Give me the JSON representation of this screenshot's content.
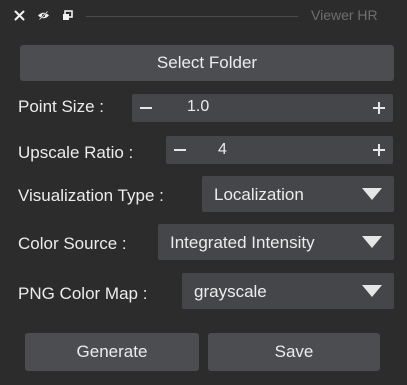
{
  "titlebar": {
    "title": "Viewer HR",
    "icons": [
      "close-icon",
      "eye-icon",
      "restore-icon"
    ]
  },
  "select_folder_label": "Select Folder",
  "point_size": {
    "label": "Point Size :",
    "value": "1.0"
  },
  "upscale_ratio": {
    "label": "Upscale Ratio :",
    "value": "4"
  },
  "visualization_type": {
    "label": "Visualization Type :",
    "selected": "Localization"
  },
  "color_source": {
    "label": "Color Source :",
    "selected": "Integrated Intensity"
  },
  "png_color_map": {
    "label": "PNG Color Map :",
    "selected": "grayscale"
  },
  "generate_label": "Generate",
  "save_label": "Save",
  "colors": {
    "background": "#2c2c2d",
    "button": "#4b4d51",
    "field": "#44464a",
    "text": "#ececec",
    "title_text": "#6f6f72"
  }
}
